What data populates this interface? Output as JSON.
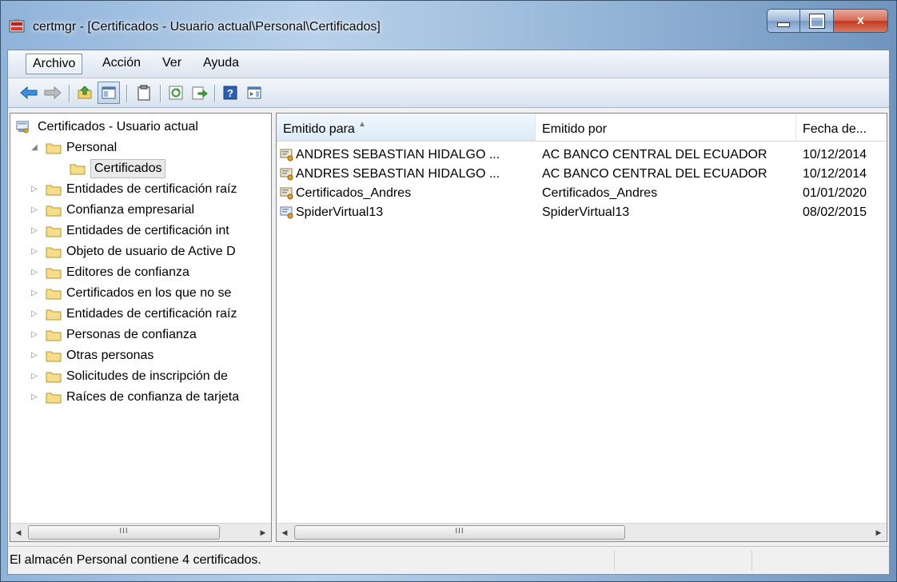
{
  "window": {
    "title": "certmgr - [Certificados - Usuario actual\\Personal\\Certificados]",
    "buttons": {
      "minimize": "minimize",
      "maximize": "maximize",
      "close": "x"
    }
  },
  "menubar": {
    "items": [
      {
        "label": "Archivo"
      },
      {
        "label": "Acción"
      },
      {
        "label": "Ver"
      },
      {
        "label": "Ayuda"
      }
    ]
  },
  "toolbar": {
    "icons": [
      "back-arrow-icon",
      "forward-arrow-icon",
      "up-folder-icon",
      "show-hide-tree-icon",
      "properties-icon",
      "refresh-icon",
      "export-list-icon",
      "help-icon",
      "action-pane-icon"
    ]
  },
  "tree": {
    "root": "Certificados - Usuario actual",
    "items": [
      {
        "label": "Personal",
        "expanded": true
      },
      {
        "label": "Certificados",
        "selected": true
      },
      {
        "label": "Entidades de certificación raíz"
      },
      {
        "label": "Confianza empresarial"
      },
      {
        "label": "Entidades de certificación int"
      },
      {
        "label": "Objeto de usuario de Active D"
      },
      {
        "label": "Editores de confianza"
      },
      {
        "label": "Certificados en los que no se"
      },
      {
        "label": "Entidades de certificación raíz"
      },
      {
        "label": "Personas de confianza"
      },
      {
        "label": "Otras personas"
      },
      {
        "label": "Solicitudes de inscripción de"
      },
      {
        "label": "Raíces de confianza de tarjeta"
      }
    ]
  },
  "list": {
    "columns": [
      "Emitido para",
      "Emitido por",
      "Fecha de..."
    ],
    "rows": [
      {
        "issued_to": "ANDRES SEBASTIAN HIDALGO ...",
        "issued_by": "AC BANCO CENTRAL DEL ECUADOR",
        "date": "10/12/2014"
      },
      {
        "issued_to": "ANDRES SEBASTIAN HIDALGO ...",
        "issued_by": "AC BANCO CENTRAL DEL ECUADOR",
        "date": "10/12/2014"
      },
      {
        "issued_to": "Certificados_Andres",
        "issued_by": "Certificados_Andres",
        "date": "01/01/2020"
      },
      {
        "issued_to": "SpiderVirtual13",
        "issued_by": "SpiderVirtual13",
        "date": "08/02/2015"
      }
    ]
  },
  "scrollbar": {
    "thumb_grip": "III"
  },
  "status": {
    "text": "El almacén Personal contiene 4 certificados."
  }
}
